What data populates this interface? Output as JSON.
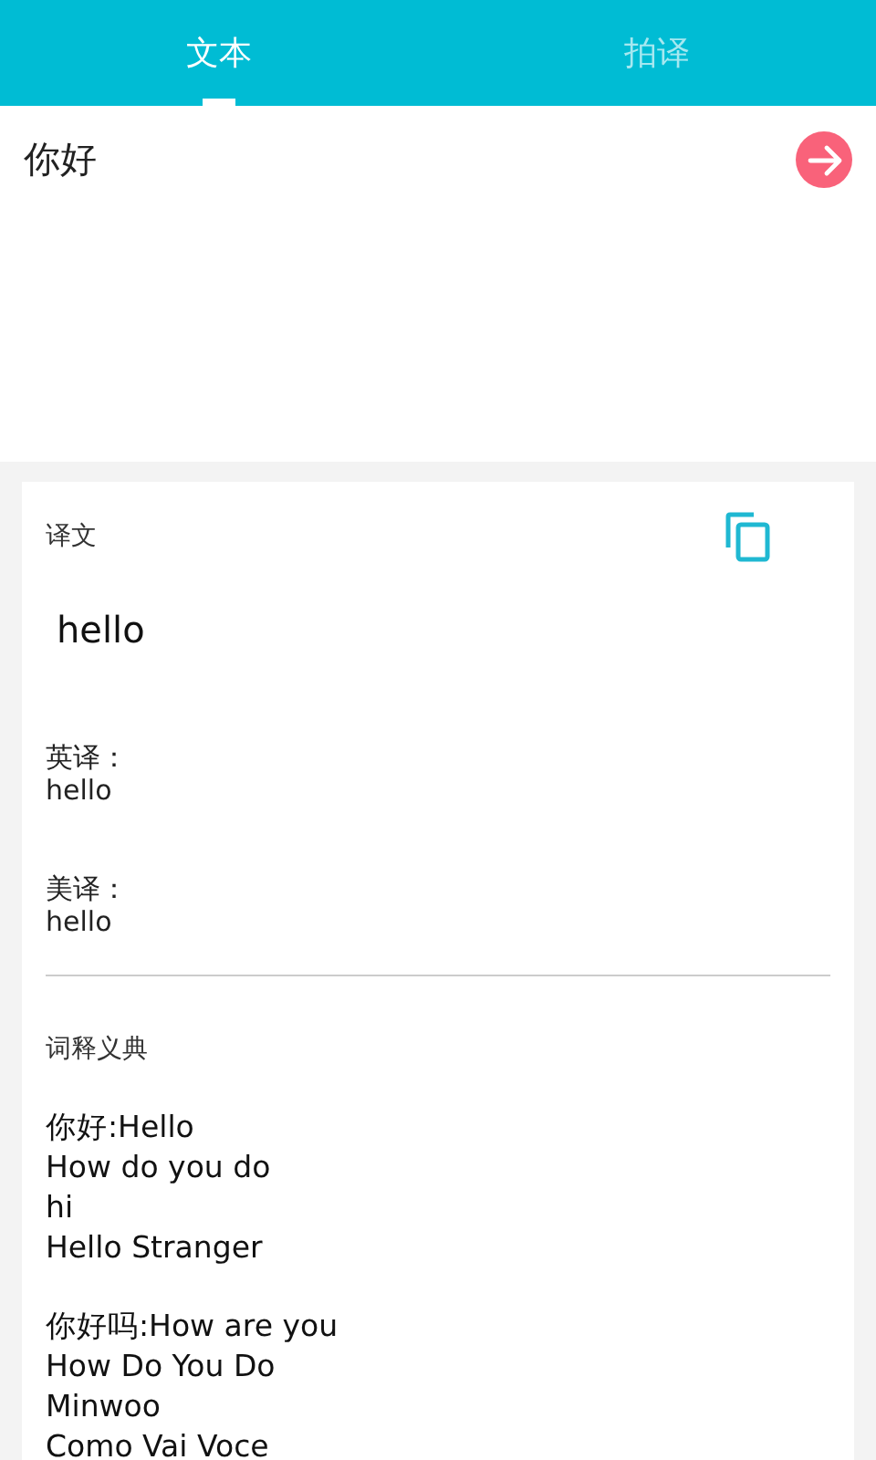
{
  "tabs": [
    {
      "label": "文本",
      "selected": true
    },
    {
      "label": "拍译",
      "selected": false
    }
  ],
  "input": {
    "value": "你好"
  },
  "translation": {
    "label": "译文",
    "text": "hello",
    "pronunciations": [
      {
        "label": "英译：",
        "value": "hello"
      },
      {
        "label": "美译：",
        "value": "hello"
      }
    ]
  },
  "dictionary": {
    "title": "词释义典",
    "entries": [
      {
        "lines": [
          "你好:Hello",
          "How do you do",
          "hi",
          "Hello Stranger"
        ]
      },
      {
        "lines": [
          "你好吗:How are you",
          "How Do You Do",
          "Minwoo",
          "Como Vai Voce"
        ]
      }
    ]
  }
}
